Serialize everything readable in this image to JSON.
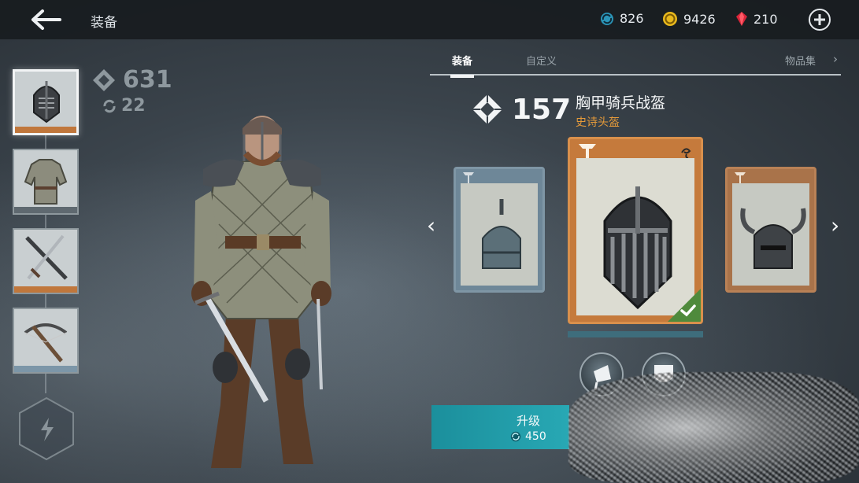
{
  "header": {
    "title": "装备",
    "currencies": {
      "gems": "826",
      "coins": "9426",
      "rubies": "210"
    }
  },
  "equipment_slots": [
    {
      "name": "头盔",
      "strip_color": "#c0773c",
      "selected": true
    },
    {
      "name": "盔甲",
      "strip_color": "#5f6970",
      "selected": false
    },
    {
      "name": "武器",
      "strip_color": "#c0773c",
      "selected": false
    },
    {
      "name": "远程武器",
      "strip_color": "#7c96a8",
      "selected": false
    }
  ],
  "character_stats": {
    "power": "631",
    "upgrade_level": "22"
  },
  "tabs": {
    "equip": "装备",
    "custom": "自定义",
    "collection": "物品集"
  },
  "item": {
    "power": "157",
    "name": "胸甲骑兵战盔",
    "rarity": "史诗头盔",
    "progress": 1.0
  },
  "colors": {
    "rarity_epic": "#e49a3a",
    "card_common": "#7f96a5",
    "card_epic": "#d9904c",
    "equipped_check": "#4f8a3c",
    "upgrade_button": "#22a0ad"
  },
  "actions": {
    "upgrade_label": "升级",
    "upgrade_cost": "450"
  },
  "icons": {
    "back": "back-arrow-icon",
    "gem": "gem-icon",
    "coin": "coin-icon",
    "ruby": "ruby-icon",
    "add": "plus-circle-icon",
    "power": "power-diamond-icon",
    "upgrade": "upgrade-cycle-icon",
    "ability": "lightning-icon"
  }
}
